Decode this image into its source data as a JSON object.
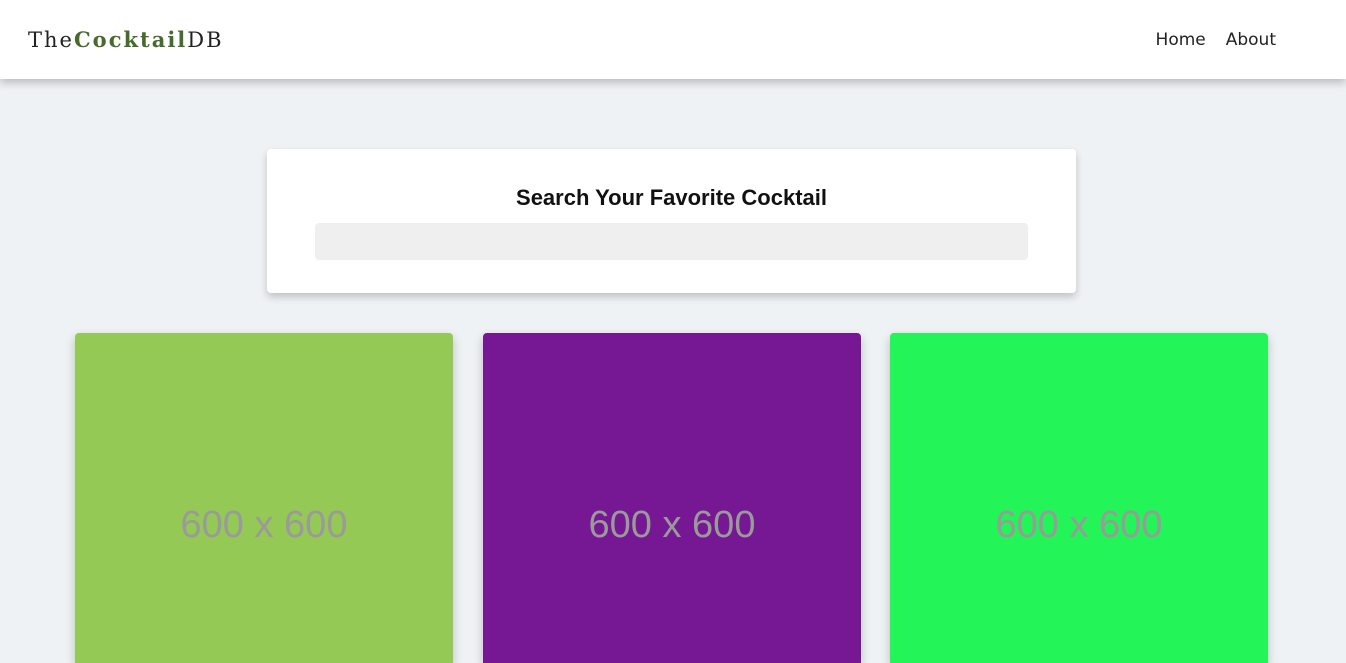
{
  "navbar": {
    "logo": {
      "prefix": "The",
      "brand": "Cocktail",
      "suffix": "DB"
    },
    "links": [
      {
        "label": "Home"
      },
      {
        "label": "About"
      }
    ]
  },
  "search": {
    "title": "Search Your Favorite Cocktail",
    "value": ""
  },
  "cocktails": [
    {
      "image_text": "600 x 600",
      "color": "#95c955"
    },
    {
      "image_text": "600 x 600",
      "color": "#761893"
    },
    {
      "image_text": "600 x 600",
      "color": "#23f457"
    }
  ]
}
